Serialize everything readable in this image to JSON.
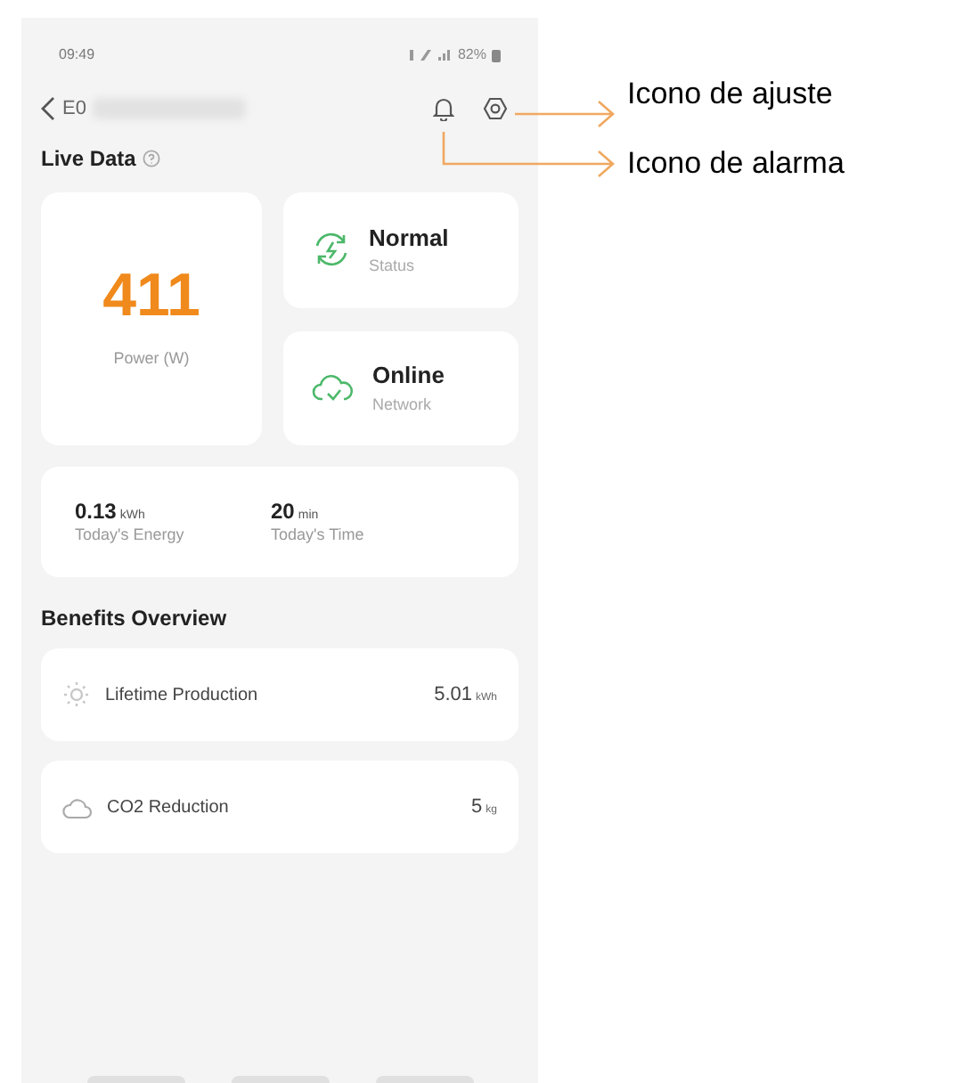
{
  "status_bar": {
    "time": "09:49",
    "battery": "82%"
  },
  "header": {
    "title": "E0"
  },
  "live_data": {
    "title": "Live Data",
    "power": {
      "value": "411",
      "label": "Power (W)"
    },
    "status": {
      "value": "Normal",
      "label": "Status"
    },
    "network": {
      "value": "Online",
      "label": "Network"
    },
    "today": [
      {
        "value": "0.13",
        "unit": "kWh",
        "label": "Today's Energy"
      },
      {
        "value": "20",
        "unit": "min",
        "label": "Today's Time"
      }
    ]
  },
  "benefits": {
    "title": "Benefits Overview",
    "items": [
      {
        "kind": "sun",
        "label": "Lifetime Production",
        "value": "5.01",
        "unit": "kWh"
      },
      {
        "kind": "cloud",
        "label": "CO2 Reduction",
        "value": "5",
        "unit": "kg"
      }
    ]
  },
  "annotations": [
    {
      "kind": "upper",
      "text": "Icono de ajuste"
    },
    {
      "kind": "lower",
      "text": "Icono de alarma"
    }
  ]
}
